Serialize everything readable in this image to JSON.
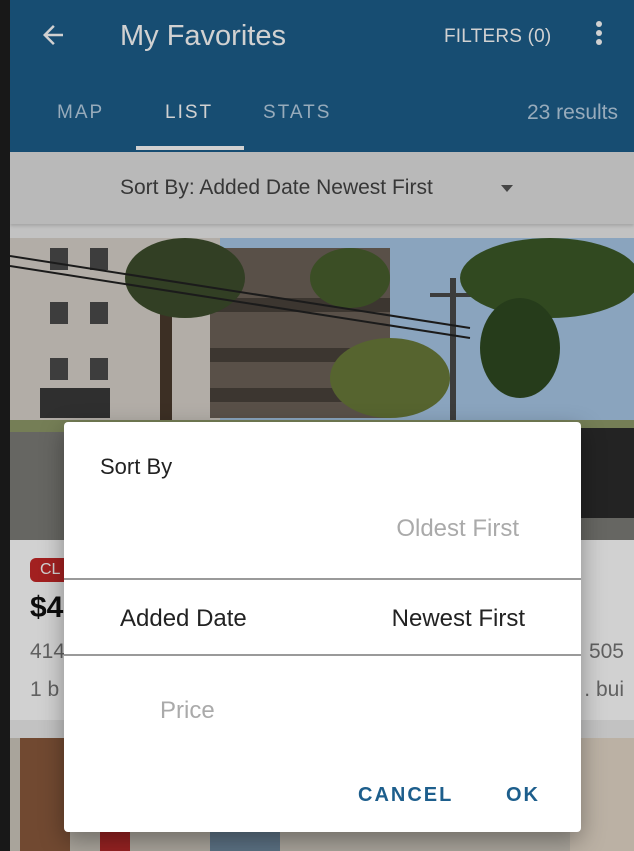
{
  "header": {
    "title": "My Favorites",
    "filters_label": "FILTERS (0)",
    "tabs": [
      {
        "label": "MAP",
        "active": false
      },
      {
        "label": "LIST",
        "active": true
      },
      {
        "label": "STATS",
        "active": false
      }
    ],
    "results": "23 results"
  },
  "sort_bar": {
    "label": "Sort By: Added Date Newest First"
  },
  "listing": {
    "badge": "CL",
    "price": "$4",
    "address_left": "414",
    "address_right": "505",
    "details_left": "1 b",
    "details_right": ". bui"
  },
  "dialog": {
    "title": "Sort By",
    "picker": {
      "above_right": "Oldest First",
      "selected_left": "Added Date",
      "selected_right": "Newest First",
      "below_left": "Price"
    },
    "cancel_label": "CANCEL",
    "ok_label": "OK"
  },
  "colors": {
    "primary": "#1d5e8c",
    "badge": "#c62828"
  },
  "icons": {
    "back": "arrow-left-icon",
    "more": "more-vertical-icon",
    "sort_dropdown": "caret-down-icon"
  }
}
